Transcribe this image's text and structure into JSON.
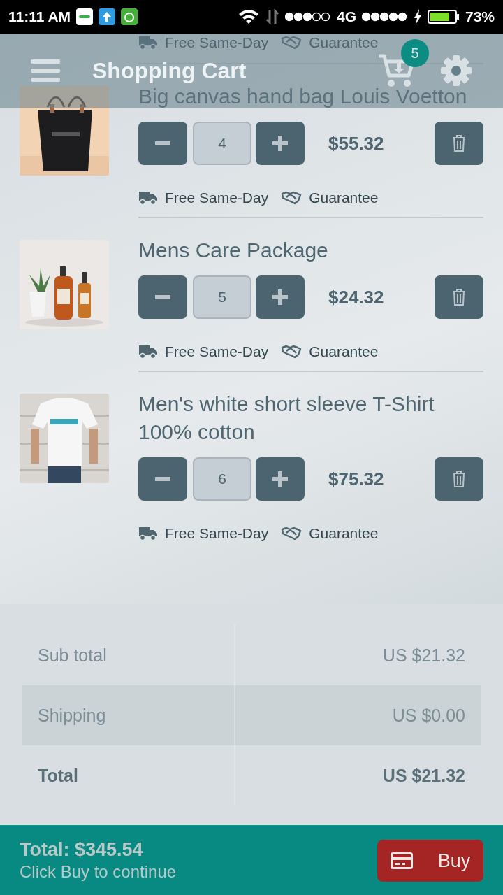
{
  "status_bar": {
    "time": "11:11 AM",
    "network": "4G",
    "battery": "73%"
  },
  "header": {
    "title": "Shopping Cart",
    "cart_count": "5"
  },
  "partial_item": {
    "features": [
      "Free Same-Day",
      "Guarantee"
    ]
  },
  "items": [
    {
      "kind": "picture",
      "title": "Big canvas hand bag Louis Voetton",
      "quantity": "4",
      "price": "$55.32",
      "features": [
        "Free Same-Day",
        "Guarantee"
      ]
    },
    {
      "kind": "picture",
      "title": "Mens Care Package",
      "quantity": "5",
      "price": "$24.32",
      "features": [
        "Free Same-Day",
        "Guarantee"
      ]
    },
    {
      "kind": "picture",
      "title": "Men's white short sleeve T-Shirt 100% cotton",
      "quantity": "6",
      "price": "$75.32",
      "features": [
        "Free Same-Day",
        "Guarantee"
      ]
    }
  ],
  "summary": [
    {
      "kind": "plain",
      "label": "Sub total",
      "value": "US $21.32"
    },
    {
      "kind": "shaded",
      "label": "Shipping",
      "value": "US $0.00"
    },
    {
      "kind": "total",
      "label": "Total",
      "value": "US $21.32"
    }
  ],
  "checkout": {
    "total": "Total: $345.54",
    "hint": "Click Buy to continue",
    "button": "Buy"
  }
}
